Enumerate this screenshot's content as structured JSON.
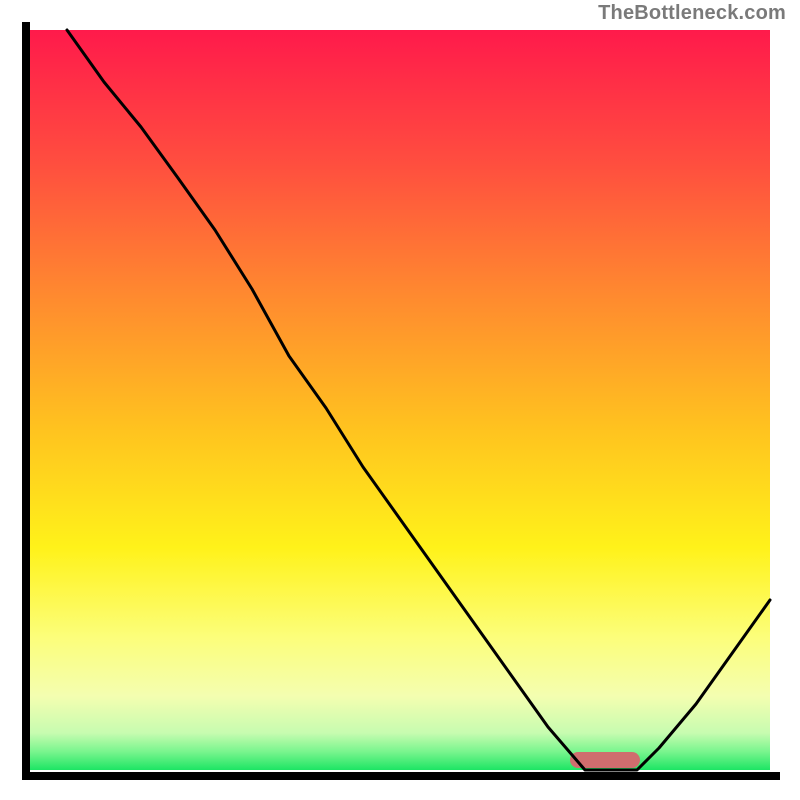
{
  "attribution": "TheBottleneck.com",
  "chart_data": {
    "type": "line",
    "title": "",
    "xlabel": "",
    "ylabel": "",
    "xlim": [
      0,
      100
    ],
    "ylim": [
      0,
      100
    ],
    "x": [
      5,
      10,
      15,
      20,
      25,
      30,
      35,
      40,
      45,
      50,
      55,
      60,
      65,
      70,
      75,
      78,
      82,
      85,
      90,
      95,
      100
    ],
    "y": [
      100,
      93,
      87,
      80,
      73,
      65,
      56,
      49,
      41,
      34,
      27,
      20,
      13,
      6,
      0,
      0,
      0,
      3,
      9,
      16,
      23
    ],
    "marker": {
      "x_start": 75,
      "x_end": 82,
      "y": 1.0,
      "color": "#cf6d6e"
    },
    "gradient_bands": [
      {
        "pos": 0.0,
        "color": "#ff1a4b"
      },
      {
        "pos": 0.18,
        "color": "#ff4e3f"
      },
      {
        "pos": 0.36,
        "color": "#ff8a2f"
      },
      {
        "pos": 0.54,
        "color": "#ffc31f"
      },
      {
        "pos": 0.7,
        "color": "#fff21a"
      },
      {
        "pos": 0.82,
        "color": "#fcfe7a"
      },
      {
        "pos": 0.9,
        "color": "#f4feb0"
      },
      {
        "pos": 0.95,
        "color": "#c7fcb0"
      },
      {
        "pos": 0.975,
        "color": "#7af58e"
      },
      {
        "pos": 1.0,
        "color": "#1de564"
      }
    ]
  }
}
